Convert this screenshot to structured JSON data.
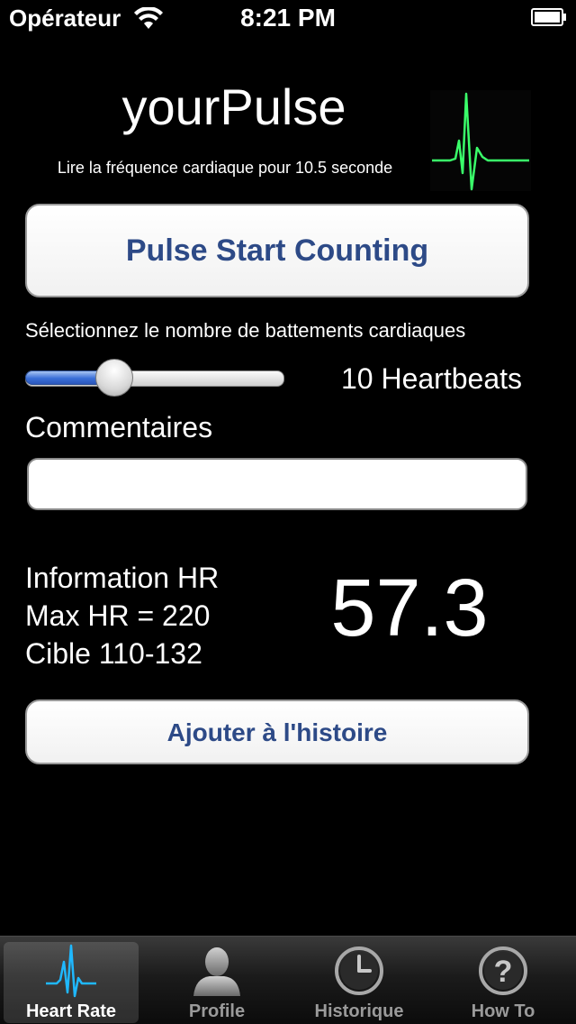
{
  "status_bar": {
    "carrier": "Opérateur",
    "time": "8:21 PM",
    "wifi_icon": "wifi-icon",
    "battery_icon": "battery-icon"
  },
  "header": {
    "title": "yourPulse",
    "subtitle": "Lire la fréquence cardiaque pour 10.5 seconde",
    "logo_icon": "ecg-logo-icon"
  },
  "actions": {
    "start_label": "Pulse Start Counting",
    "add_label": "Ajouter à l'histoire"
  },
  "heartbeats": {
    "label": "Sélectionnez le nombre de battements cardiaques",
    "slider_fraction": 0.32,
    "value_text": "10 Heartbeats"
  },
  "comments": {
    "label": "Commentaires",
    "value": "",
    "placeholder": ""
  },
  "hr_info": {
    "title": "Information HR",
    "max_hr": "Max HR = 220",
    "target": "Cible 110-132",
    "value": "57.3"
  },
  "tabs": [
    {
      "label": "Heart Rate",
      "icon": "heart-rate-icon",
      "active": true
    },
    {
      "label": "Profile",
      "icon": "person-icon",
      "active": false
    },
    {
      "label": "Historique",
      "icon": "clock-icon",
      "active": false
    },
    {
      "label": "How To",
      "icon": "question-icon",
      "active": false
    }
  ],
  "colors": {
    "button_text": "#2d4a87",
    "slider_fill": "#3a6fd8",
    "ecg_trace": "#3aff6a",
    "tab_highlight": "#1fb8ff"
  }
}
